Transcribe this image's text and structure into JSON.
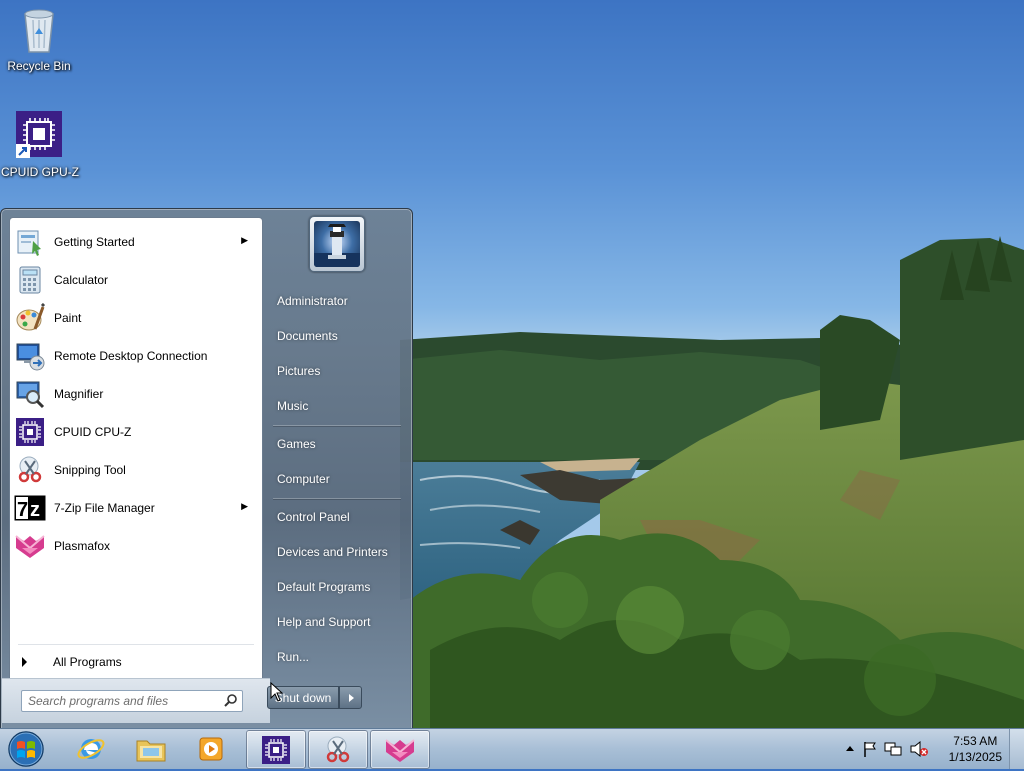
{
  "desktop": {
    "icons": [
      {
        "label": "Recycle Bin",
        "icon": "recycle-bin-icon"
      },
      {
        "label": "CPUID GPU-Z",
        "icon": "gpu-z-icon"
      }
    ]
  },
  "start_menu": {
    "pinned_programs": [
      {
        "label": "Getting Started",
        "icon": "getting-started-icon",
        "has_submenu": true
      },
      {
        "label": "Calculator",
        "icon": "calculator-icon",
        "has_submenu": false
      },
      {
        "label": "Paint",
        "icon": "paint-icon",
        "has_submenu": false
      },
      {
        "label": "Remote Desktop Connection",
        "icon": "remote-desktop-icon",
        "has_submenu": false
      },
      {
        "label": "Magnifier",
        "icon": "magnifier-icon",
        "has_submenu": false
      },
      {
        "label": "CPUID CPU-Z",
        "icon": "cpu-z-icon",
        "has_submenu": false
      },
      {
        "label": "Snipping Tool",
        "icon": "snipping-tool-icon",
        "has_submenu": false
      },
      {
        "label": "7-Zip File Manager",
        "icon": "seven-zip-icon",
        "has_submenu": true
      },
      {
        "label": "Plasmafox",
        "icon": "plasmafox-icon",
        "has_submenu": false
      }
    ],
    "all_programs_label": "All Programs",
    "search_placeholder": "Search programs and files",
    "right_items": [
      {
        "label": "Administrator"
      },
      {
        "label": "Documents"
      },
      {
        "label": "Pictures"
      },
      {
        "label": "Music"
      },
      {
        "label": "Games"
      },
      {
        "label": "Computer"
      },
      {
        "label": "Control Panel"
      },
      {
        "label": "Devices and Printers"
      },
      {
        "label": "Default Programs"
      },
      {
        "label": "Help and Support"
      },
      {
        "label": "Run..."
      }
    ],
    "shutdown_label": "Shut down"
  },
  "taskbar": {
    "pinned": [
      {
        "icon": "internet-explorer-icon"
      },
      {
        "icon": "windows-explorer-icon"
      },
      {
        "icon": "media-player-icon"
      },
      {
        "icon": "cpu-z-icon",
        "active": true
      },
      {
        "icon": "snipping-tool-icon",
        "active": true
      },
      {
        "icon": "plasmafox-icon",
        "active": true
      }
    ],
    "tray_icons": [
      "show-hidden-icons-arrow",
      "action-center-flag-icon",
      "network-icon",
      "volume-muted-icon"
    ],
    "time": "7:53 AM",
    "date": "1/13/2025"
  },
  "colors": {
    "accent_purple": "#3b1f86",
    "plasmafox_pink": "#d63c8f",
    "taskbar_blue": "#a8bfd6"
  }
}
